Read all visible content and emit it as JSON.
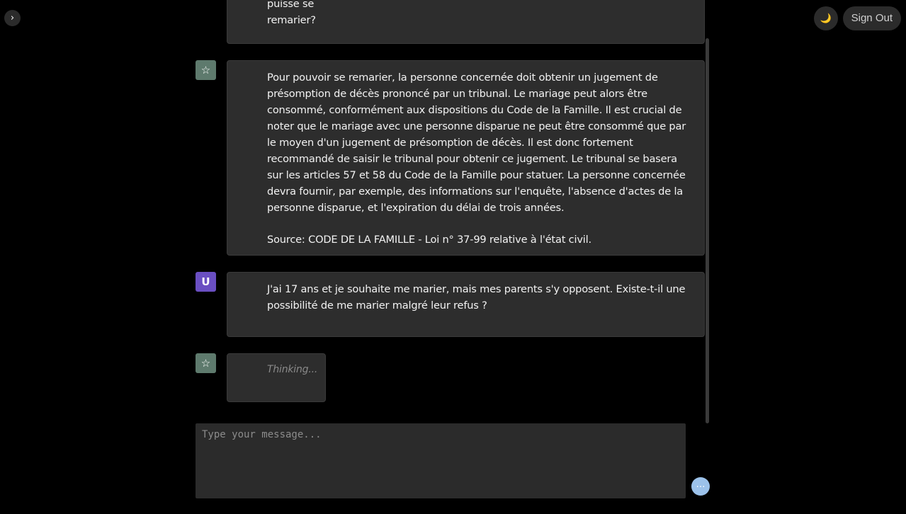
{
  "header": {
    "sidebar_toggle_glyph": "›",
    "theme_icon": "moon-icon",
    "theme_glyph": "🌙",
    "signout_label": "Sign Out"
  },
  "messages": [
    {
      "role": "user",
      "avatar_label": "",
      "lines": [
        "Quelles sont les conditions pour qu'une personne dont le conjoint est disparu puisse se",
        "remarier?"
      ]
    },
    {
      "role": "assistant",
      "avatar_icon": "star-icon",
      "avatar_glyph": "☆",
      "paragraph": "Pour pouvoir se remarier, la personne concernée doit obtenir un jugement de présomption de décès prononcé par un tribunal. Le mariage peut alors être consommé, conformément aux dispositions du Code de la Famille. Il est crucial de noter que le mariage avec une personne disparue ne peut être consommé que par le moyen d'un jugement de présomption de décès. Il est donc fortement recommandé de saisir le tribunal pour obtenir ce jugement. Le tribunal se basera sur les articles 57 et 58 du Code de la Famille pour statuer. La personne concernée devra fournir, par exemple, des informations sur l'enquête, l'absence d'actes de la personne disparue, et l'expiration du délai de trois années.",
      "source": "Source: CODE DE LA FAMILLE - Loi n° 37-99 relative à l'état civil."
    },
    {
      "role": "user",
      "avatar_label": "U",
      "text": "J'ai 17 ans et je souhaite me marier, mais mes parents s'y opposent. Existe-t-il une possibilité de me marier malgré leur refus ?"
    },
    {
      "role": "assistant",
      "avatar_icon": "star-icon",
      "avatar_glyph": "☆",
      "status": "Thinking..."
    }
  ],
  "composer": {
    "placeholder": "Type your message...",
    "value": "",
    "send_glyph": "…"
  },
  "colors": {
    "background": "#000000",
    "bubble": "#2d2d2d",
    "bot_avatar": "#5e7a6d",
    "user_avatar": "#6a4fc2",
    "send_button": "#9cc2ea"
  }
}
